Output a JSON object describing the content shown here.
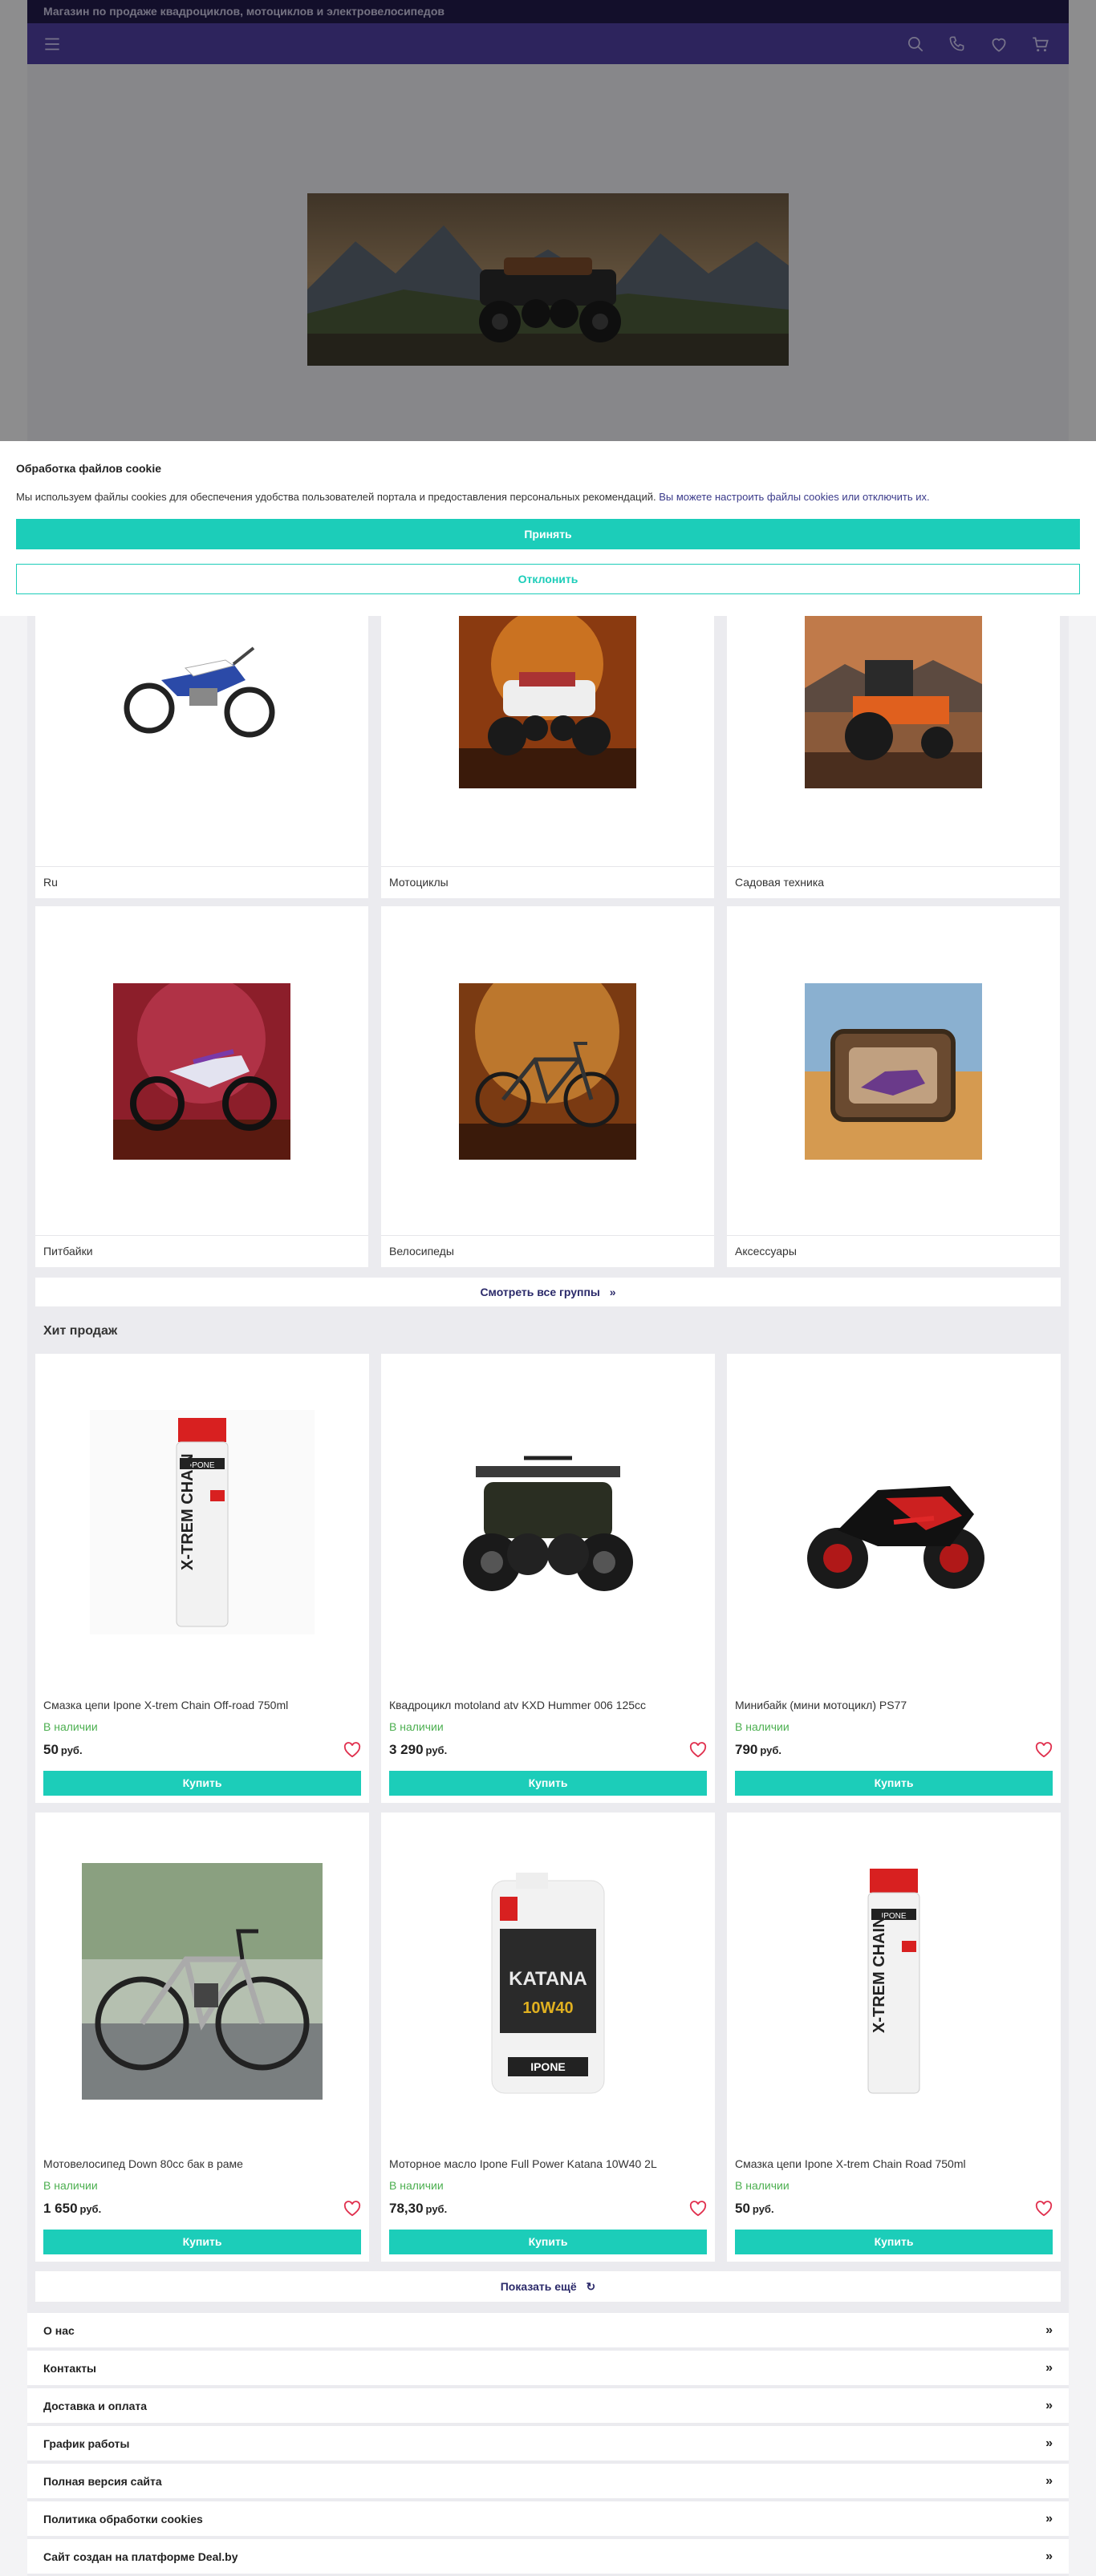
{
  "topbar": {
    "title": "Магазин по продаже квадроциклов, мотоциклов и электровелосипедов"
  },
  "cookie": {
    "title": "Обработка файлов cookie",
    "text": "Мы используем файлы cookies для обеспечения удобства пользователей портала и предоставления персональных рекомендаций.",
    "link_text": "Вы можете настроить файлы cookies или отключить их.",
    "accept": "Принять",
    "decline": "Отклонить"
  },
  "categories": [
    {
      "name": "Ru"
    },
    {
      "name": "Мотоциклы"
    },
    {
      "name": "Садовая техника"
    },
    {
      "name": "Питбайки"
    },
    {
      "name": "Велосипеды"
    },
    {
      "name": "Аксессуары"
    }
  ],
  "see_all": "Смотреть все группы",
  "hits": {
    "title": "Хит продаж",
    "buy_label": "Купить",
    "products": [
      {
        "name": "Смазка цепи Ipone X-trem Chain Off-road 750ml",
        "stock": "В наличии",
        "price": "50",
        "currency": "руб."
      },
      {
        "name": "Квадроцикл motoland atv KXD Hummer 006 125cc",
        "stock": "В наличии",
        "price": "3 290",
        "currency": "руб."
      },
      {
        "name": "Минибайк (мини мотоцикл) PS77",
        "stock": "В наличии",
        "price": "790",
        "currency": "руб."
      },
      {
        "name": "Мотовелосипед Down 80cc бак в раме",
        "stock": "В наличии",
        "price": "1 650",
        "currency": "руб."
      },
      {
        "name": "Моторное масло Ipone Full Power Katana 10W40 2L",
        "stock": "В наличии",
        "price": "78,30",
        "currency": "руб."
      },
      {
        "name": "Смазка цепи Ipone X-trem Chain Road 750ml",
        "stock": "В наличии",
        "price": "50",
        "currency": "руб."
      }
    ]
  },
  "show_more": "Показать ещё",
  "footer": [
    {
      "label": "О нас"
    },
    {
      "label": "Контакты"
    },
    {
      "label": "Доставка и оплата"
    },
    {
      "label": "График работы"
    },
    {
      "label": "Полная версия сайта"
    },
    {
      "label": "Политика обработки cookies"
    },
    {
      "label": "Сайт создан на платформе Deal.by"
    }
  ],
  "colors": {
    "accent": "#1ccdb9",
    "nav": "#4e3fa0",
    "topbar": "#221a4a",
    "stock": "#4caf50"
  }
}
